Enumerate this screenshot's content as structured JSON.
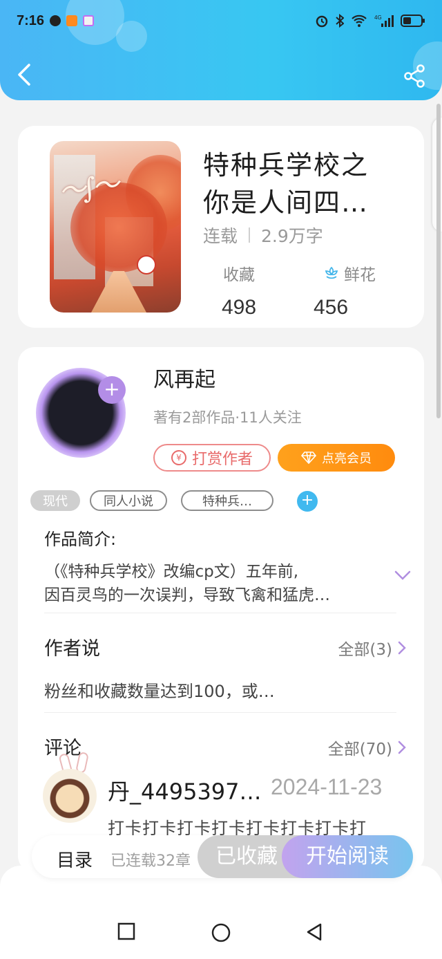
{
  "status_bar": {
    "time": "7:16",
    "icons": [
      "qq-icon",
      "video-app-icon",
      "camera-app-icon",
      "alarm-icon",
      "bluetooth-icon",
      "wifi-icon",
      "signal-4g-icon",
      "battery-icon"
    ],
    "network": "4G"
  },
  "header": {
    "back_icon": "chevron-left-icon",
    "share_icon": "share-icon",
    "accent": "#3fbef3"
  },
  "book": {
    "title_line1": "特种兵学校之",
    "title_line2": "你是人间四…",
    "status": "连载",
    "word_count": "2.9万字",
    "favorites_label": "收藏",
    "favorites_value": "498",
    "flowers_label": "鲜花",
    "flowers_value": "456"
  },
  "author": {
    "name": "风再起",
    "summary": "著有2部作品·11人关注",
    "tip_label": "打赏作者",
    "vip_label": "点亮会员",
    "follow_symbol": "+"
  },
  "tags": [
    "现代",
    "同人小说",
    "特种兵…"
  ],
  "tag_add_symbol": "+",
  "intro": {
    "title": "作品简介:",
    "line1": "（《特种兵学校》改编cp文）五年前,",
    "line2": "因百灵鸟的一次误判，导致飞禽和猛虎…"
  },
  "author_say": {
    "title": "作者说",
    "all_label": "全部(3)",
    "text": "粉丝和收藏数量达到100，或…"
  },
  "comments": {
    "title": "评论",
    "all_label": "全部(70)",
    "first": {
      "name": "丹_4495397…",
      "date": "2024-11-23",
      "text": "打卡打卡打卡打卡打卡打卡打卡打"
    }
  },
  "action_bar": {
    "toc_label": "目录",
    "toc_progress": "已连载32章",
    "favorited_label": "已收藏",
    "read_label": "开始阅读"
  },
  "colors": {
    "tip_red": "#e86a6a",
    "vip_orange": "#ff9414",
    "tag_add_blue": "#41b9ef",
    "avatar_plus_purple": "#b38de7"
  }
}
